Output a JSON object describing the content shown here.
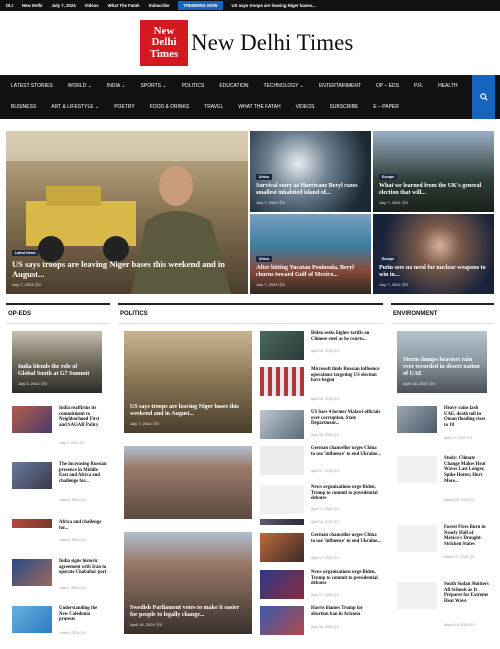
{
  "topbar": {
    "tag": "DLI",
    "items": [
      "New Delhi",
      "July 7, 2024",
      "Videos",
      "What The Fatah",
      "Subscribe"
    ],
    "trending": "TRENDING NOW",
    "headline": "US says troops are leaving Niger bases..."
  },
  "logo": {
    "mark": [
      "New",
      "Delhi",
      "Times"
    ],
    "name": "New Delhi Times"
  },
  "nav": {
    "row1": [
      "LATEST STORIES",
      "WORLD ⌄",
      "INDIA ⌄",
      "SPORTS ⌄",
      "POLITICS",
      "EDUCATION",
      "TECHNOLOGY ⌄",
      "ENTERTAINMENT",
      "OP – EDS",
      "P.R.",
      "HEALTH"
    ],
    "row2": [
      "BUSINESS",
      "ART & LIFESTYLE ⌄",
      "POETRY",
      "FOOD & DRINKS",
      "TRAVEL",
      "WHAT THE FATAH",
      "VIDEOS",
      "SUBSCRIBE",
      "E – PAPER"
    ]
  },
  "hero": {
    "main": {
      "cat": "Latest News",
      "title": "US says troops are leaving Niger bases this weekend and in August...",
      "meta": "July 7, 2024  ⓪0"
    },
    "t1": {
      "cat": "Africa",
      "title": "Survival story as Hurricane Beryl razes smallest inhabited island of...",
      "meta": "July 7, 2024  ⓪0"
    },
    "t2": {
      "cat": "Europe",
      "title": "What we learned from the UK's general election that will...",
      "meta": "July 7, 2024  ⓪0"
    },
    "t3": {
      "cat": "Africa",
      "title": "After hitting Yucatan Peninsula, Beryl churns toward Gulf of Mexico...",
      "meta": "July 7, 2024  ⓪0"
    },
    "t4": {
      "cat": "Europe",
      "title": "Putin sees no need for nuclear weapons to win in...",
      "meta": "July 7, 2024  ⓪0"
    }
  },
  "oped": {
    "title": "OP-EDS",
    "lead": {
      "title": "India blends the role of Global South at G7 Summit",
      "meta": "July 5, 2024  ⓪0"
    },
    "items": [
      {
        "title": "India reaffirms its commitment to Neighborhood First and SAGAR Policy",
        "meta": "July 2, 2024  ⓪0"
      },
      {
        "title": "The increasing Russian presence in Middle East and Africa and challenge for...",
        "meta": "June 8, 2024  ⓪0"
      },
      {
        "title": "Africa and challenge for...",
        "meta": "June 8, 2024  ⓪0"
      },
      {
        "title": "India signs historic agreement with Iran to operate Chabahar port",
        "meta": "June 1, 2024  ⓪0"
      },
      {
        "title": "Understanding the New Caledonia protests",
        "meta": "June 8, 2024  ⓪0"
      }
    ]
  },
  "politics": {
    "title": "POLITICS",
    "lead1": {
      "title": "US says troops are leaving Niger bases this weekend and in August...",
      "meta": "July 7, 2024  ⓪0"
    },
    "lead2": {
      "title": "Swedish Parliament votes to make it easier for people to legally change...",
      "meta": "April 18, 2024  ⓪0"
    },
    "items": [
      {
        "title": "Biden seeks higher tariffs on Chinese steel as he courts...",
        "meta": "April 18, 2024  ⓪0"
      },
      {
        "title": "Microsoft finds Russian influence operations targeting US election have begun",
        "meta": "April 18, 2024  ⓪0"
      },
      {
        "title": "US bars 4 former Malawi officials over corruption, State Department...",
        "meta": "April 18, 2024  ⓪0"
      },
      {
        "title": "German chancellor urges China to use 'influence' to end Ukraine...",
        "meta": "April 17, 2024  ⓪0"
      },
      {
        "title": "News organizations urge Biden, Trump to commit to presidential debates",
        "meta": "April 17, 2024  ⓪0"
      },
      {
        "title": "",
        "meta": "April 16, 2024  ⓪0"
      },
      {
        "title": "German chancellor urges China to use 'influence' to end Ukraine...",
        "meta": "April 17, 2024  ⓪0"
      },
      {
        "title": "News organizations urge Biden, Trump to commit to presidential debates",
        "meta": "April 17, 2024  ⓪0"
      },
      {
        "title": "Harris blames Trump for abortion ban in Arizona",
        "meta": "April 16, 2024  ⓪0"
      }
    ]
  },
  "environment": {
    "title": "ENVIRONMENT",
    "lead": {
      "title": "Storm dumps heaviest rain ever recorded in desert nation of UAE",
      "meta": "April 18, 2024  ⓪0"
    },
    "items": [
      {
        "title": "Heavy rains lash UAE, death toll in Oman flooding rises to 18",
        "meta": "April 17, 2024  ⓪0"
      },
      {
        "title": "Study: Climate Change Makes Heat Waves Last Longer, Spike Hotter, Hurt More...",
        "meta": "March 28, 2024  ⓪0"
      },
      {
        "title": "Forest Fires Burn in Nearly Half of Mexico's Drought-Stricken States",
        "meta": "March 27, 2024  ⓪0"
      },
      {
        "title": "South Sudan Shutters All Schools as It Prepares for Extreme Heat Wave",
        "meta": "March 18, 2024  ⓪0"
      }
    ]
  }
}
